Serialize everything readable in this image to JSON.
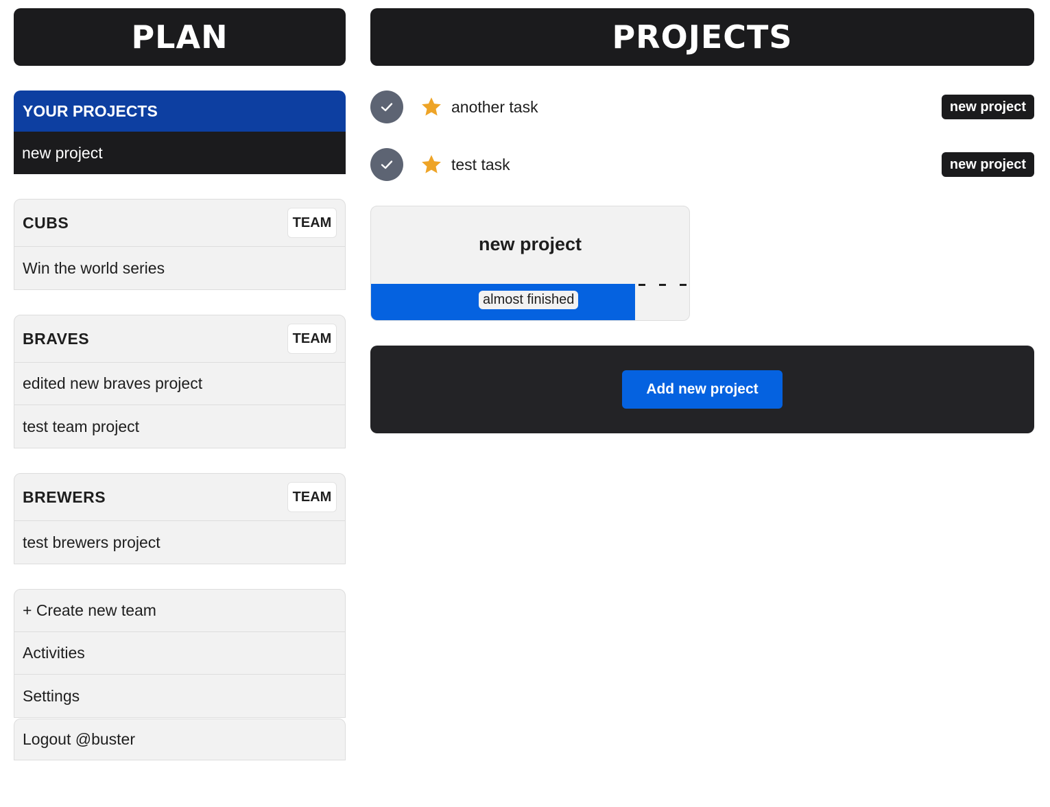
{
  "sidebar": {
    "title": "PLAN",
    "your_projects": {
      "heading": "YOUR PROJECTS",
      "items": [
        {
          "label": "new project"
        }
      ]
    },
    "teams": [
      {
        "name": "CUBS",
        "badge": "TEAM",
        "projects": [
          {
            "label": "Win the world series"
          }
        ]
      },
      {
        "name": "BRAVES",
        "badge": "TEAM",
        "projects": [
          {
            "label": "edited new braves project"
          },
          {
            "label": "test team project"
          }
        ]
      },
      {
        "name": "BREWERS",
        "badge": "TEAM",
        "projects": [
          {
            "label": "test brewers project"
          }
        ]
      }
    ],
    "menu": {
      "create_team": "+ Create new team",
      "activities": "Activities",
      "settings": "Settings",
      "logout": "Logout @buster"
    }
  },
  "main": {
    "title": "PROJECTS",
    "tasks": [
      {
        "title": "another task",
        "project_tag": "new project",
        "check_icon": "checkmark-icon",
        "star_icon": "star-icon"
      },
      {
        "title": "test task",
        "project_tag": "new project",
        "check_icon": "checkmark-icon",
        "star_icon": "star-icon"
      }
    ],
    "project_card": {
      "title": "new project",
      "status_label": "almost finished",
      "progress": 0.83
    },
    "add_button_label": "Add new project"
  },
  "colors": {
    "dark": "#1b1b1d",
    "panel_dark": "#232326",
    "accent_blue": "#0562e0",
    "header_blue": "#0d3fa1",
    "check_gray": "#5d6473",
    "star_gold": "#eea427",
    "light_panel": "#f2f2f2"
  }
}
